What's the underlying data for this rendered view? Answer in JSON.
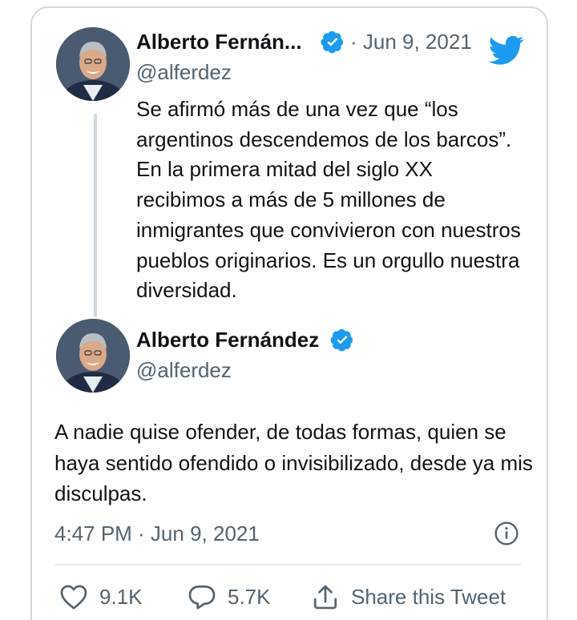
{
  "parent_tweet": {
    "author_name": "Alberto Fernán...",
    "handle": "@alferdez",
    "date": "· Jun 9, 2021",
    "text": "Se afirmó más de una vez que “los argentinos descendemos de los barcos”. En la primera mitad del siglo XX recibimos a más de 5 millones de inmigrantes que convivieron con nuestros pueblos originarios. Es un orgullo nuestra diversidad."
  },
  "main_tweet": {
    "author_name": "Alberto Fernández",
    "handle": "@alferdez",
    "text": "A nadie quise ofender, de todas formas, quien se haya sentido ofendido o invisibilizado, desde ya mis disculpas.",
    "timestamp": "4:47 PM · Jun 9, 2021"
  },
  "actions": {
    "likes": "9.1K",
    "replies": "5.7K",
    "share_label": "Share this Tweet"
  },
  "colors": {
    "verified_blue": "#1d9bf0",
    "twitter_blue": "#1d9bf0",
    "secondary_text": "#536471",
    "border": "#cfd9de"
  },
  "icons": [
    "twitter-logo-icon",
    "verified-badge-icon",
    "info-icon",
    "heart-icon",
    "reply-bubble-icon",
    "share-icon"
  ]
}
